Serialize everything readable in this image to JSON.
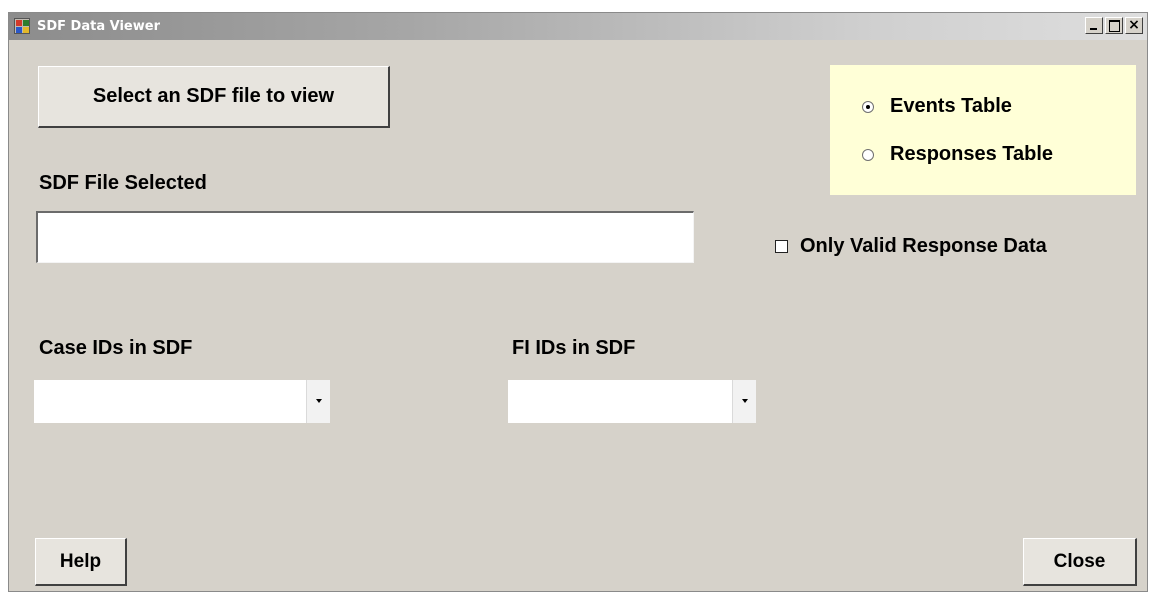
{
  "window": {
    "title": "SDF Data Viewer"
  },
  "buttons": {
    "select_file": "Select an SDF file to view",
    "help": "Help",
    "close": "Close"
  },
  "file": {
    "label": "SDF File Selected",
    "value": ""
  },
  "table_choice": {
    "options": [
      {
        "label": "Events Table",
        "selected": true
      },
      {
        "label": "Responses Table",
        "selected": false
      }
    ]
  },
  "only_valid": {
    "label": "Only Valid Response Data",
    "checked": false
  },
  "case_ids": {
    "label": "Case IDs in SDF",
    "value": ""
  },
  "fi_ids": {
    "label": "FI IDs in SDF",
    "value": ""
  },
  "colors": {
    "window_bg": "#d6d2ca",
    "option_panel_bg": "#ffffd7"
  }
}
